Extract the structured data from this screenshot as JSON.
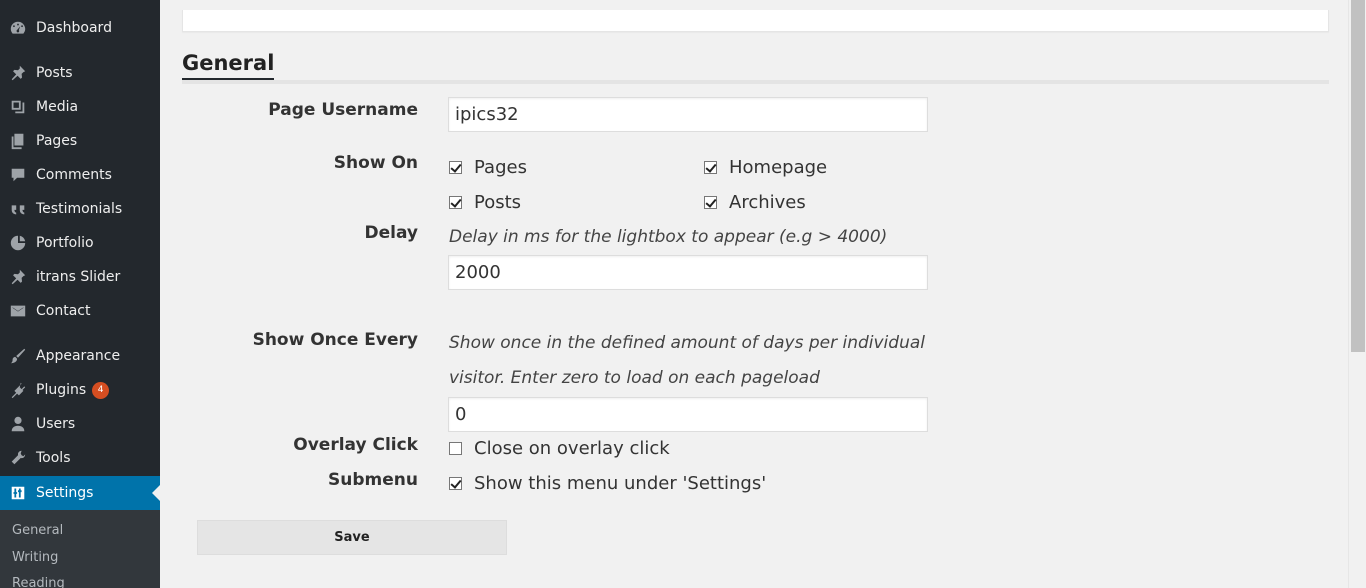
{
  "sidebar": {
    "items": [
      {
        "label": "Dashboard",
        "icon": "dashboard-icon"
      },
      {
        "label": "Posts",
        "icon": "pin-icon"
      },
      {
        "label": "Media",
        "icon": "media-icon"
      },
      {
        "label": "Pages",
        "icon": "pages-icon"
      },
      {
        "label": "Comments",
        "icon": "comment-icon"
      },
      {
        "label": "Testimonials",
        "icon": "quote-icon"
      },
      {
        "label": "Portfolio",
        "icon": "portfolio-icon"
      },
      {
        "label": "itrans Slider",
        "icon": "pin-icon"
      },
      {
        "label": "Contact",
        "icon": "mail-icon"
      },
      {
        "label": "Appearance",
        "icon": "brush-icon"
      },
      {
        "label": "Plugins",
        "icon": "plugin-icon",
        "badge": "4"
      },
      {
        "label": "Users",
        "icon": "user-icon"
      },
      {
        "label": "Tools",
        "icon": "wrench-icon"
      },
      {
        "label": "Settings",
        "icon": "settings-icon"
      }
    ],
    "submenu": [
      "General",
      "Writing",
      "Reading"
    ]
  },
  "form": {
    "section_title": "General",
    "page_username": {
      "label": "Page Username",
      "value": "ipics32"
    },
    "show_on": {
      "label": "Show On",
      "options": [
        {
          "label": "Pages",
          "checked": true
        },
        {
          "label": "Homepage",
          "checked": true
        },
        {
          "label": "Posts",
          "checked": true
        },
        {
          "label": "Archives",
          "checked": true
        }
      ]
    },
    "delay": {
      "label": "Delay",
      "description": "Delay in ms for the lightbox to appear (e.g > 4000)",
      "value": "2000"
    },
    "show_once": {
      "label": "Show Once Every",
      "description_line1": "Show once in the defined amount of days per individual",
      "description_line2": "visitor. Enter zero to load on each pageload",
      "value": "0"
    },
    "overlay_click": {
      "label": "Overlay Click",
      "option": "Close on overlay click",
      "checked": false
    },
    "submenu": {
      "label": "Submenu",
      "option": "Show this menu under 'Settings'",
      "checked": true
    },
    "save_label": "Save"
  },
  "colors": {
    "sidebar_bg": "#23282d",
    "accent": "#0073aa",
    "badge": "#d54e21"
  }
}
